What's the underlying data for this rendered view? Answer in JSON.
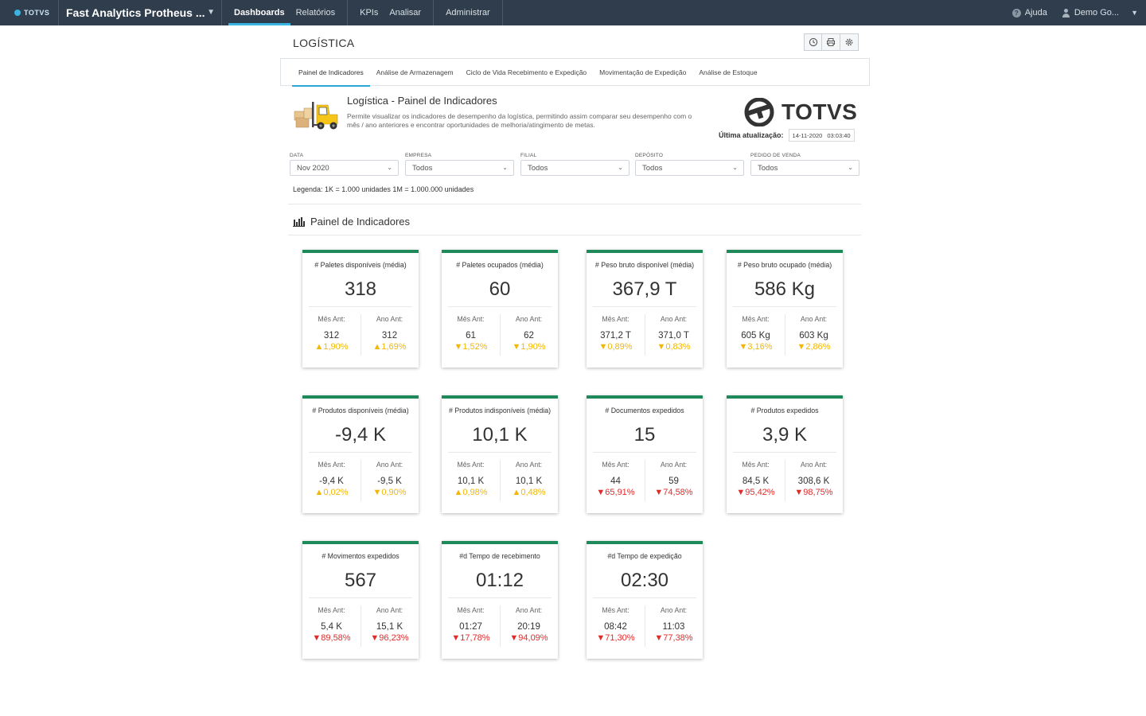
{
  "topbar": {
    "logo": "TOTVS",
    "app_name": "Fast Analytics Protheus ...",
    "nav_group1": [
      "Dashboards",
      "Relatórios"
    ],
    "nav_group2": [
      "KPIs",
      "Analisar"
    ],
    "nav_group3": [
      "Administrar"
    ],
    "help": "Ajuda",
    "user": "Demo Go..."
  },
  "page": {
    "title": "LOGÍSTICA",
    "tabs": [
      "Painel de Indicadores",
      "Análise de Armazenagem",
      "Ciclo de Vida Recebimento e Expedição",
      "Movimentação de Expedição",
      "Análise de Estoque"
    ],
    "active_tab": 0
  },
  "intro": {
    "title": "Logística - Painel de Indicadores",
    "description": "Permite visualizar os indicadores de desempenho da logística, permitindo assim comparar seu desempenho com o mês / ano anteriores e encontrar oportunidades de melhoria/atingimento de metas.",
    "brand": "TOTVS",
    "updated_label": "Última atualização:",
    "updated_date": "14-11-2020",
    "updated_time": "03:03:40"
  },
  "filters": [
    {
      "label": "DATA",
      "value": "Nov 2020"
    },
    {
      "label": "EMPRESA",
      "value": "Todos"
    },
    {
      "label": "FILIAL",
      "value": "Todos"
    },
    {
      "label": "DEPÓSITO",
      "value": "Todos"
    },
    {
      "label": "PEDIDO DE VENDA",
      "value": "Todos"
    }
  ],
  "legend": "Legenda: 1K = 1.000 unidades 1M = 1.000.000 unidades",
  "section_title": "Painel de Indicadores",
  "prev_month_label": "Mês Ant:",
  "prev_year_label": "Ano Ant:",
  "colors": {
    "accent": "#1e8a5a",
    "topbar": "#2f3d4c",
    "tab_active": "#2aa6d6",
    "warn": "#f2b705",
    "bad": "#e02b2b"
  },
  "cards": [
    {
      "title": "# Paletes disponíveis (média)",
      "value": "318",
      "prev_month": "312",
      "pm_change": "▲1,90%",
      "pm_color": "y",
      "prev_year": "312",
      "py_change": "▲1,69%",
      "py_color": "y"
    },
    {
      "title": "# Paletes ocupados (média)",
      "value": "60",
      "prev_month": "61",
      "pm_change": "▼1,52%",
      "pm_color": "y",
      "prev_year": "62",
      "py_change": "▼1,90%",
      "py_color": "y"
    },
    {
      "title": "# Peso bruto disponível (média)",
      "value": "367,9 T",
      "prev_month": "371,2 T",
      "pm_change": "▼0,89%",
      "pm_color": "y",
      "prev_year": "371,0 T",
      "py_change": "▼0,83%",
      "py_color": "y"
    },
    {
      "title": "# Peso bruto ocupado (média)",
      "value": "586 Kg",
      "prev_month": "605 Kg",
      "pm_change": "▼3,16%",
      "pm_color": "y",
      "prev_year": "603 Kg",
      "py_change": "▼2,86%",
      "py_color": "y"
    },
    {
      "title": "# Produtos disponíveis (média)",
      "value": "-9,4 K",
      "prev_month": "-9,4 K",
      "pm_change": "▲0,02%",
      "pm_color": "y",
      "prev_year": "-9,5 K",
      "py_change": "▼0,90%",
      "py_color": "y"
    },
    {
      "title": "# Produtos indisponíveis (média)",
      "value": "10,1 K",
      "prev_month": "10,1 K",
      "pm_change": "▲0,98%",
      "pm_color": "y",
      "prev_year": "10,1 K",
      "py_change": "▲0,48%",
      "py_color": "y"
    },
    {
      "title": "# Documentos expedidos",
      "value": "15",
      "prev_month": "44",
      "pm_change": "▼65,91%",
      "pm_color": "r",
      "prev_year": "59",
      "py_change": "▼74,58%",
      "py_color": "r"
    },
    {
      "title": "# Produtos expedidos",
      "value": "3,9 K",
      "prev_month": "84,5 K",
      "pm_change": "▼95,42%",
      "pm_color": "r",
      "prev_year": "308,6 K",
      "py_change": "▼98,75%",
      "py_color": "r"
    },
    {
      "title": "# Movimentos expedidos",
      "value": "567",
      "prev_month": "5,4 K",
      "pm_change": "▼89,58%",
      "pm_color": "r",
      "prev_year": "15,1 K",
      "py_change": "▼96,23%",
      "py_color": "r"
    },
    {
      "title": "#d Tempo de recebimento",
      "value": "01:12",
      "prev_month": "01:27",
      "pm_change": "▼17,78%",
      "pm_color": "r",
      "prev_year": "20:19",
      "py_change": "▼94,09%",
      "py_color": "r"
    },
    {
      "title": "#d Tempo de expedição",
      "value": "02:30",
      "prev_month": "08:42",
      "pm_change": "▼71,30%",
      "pm_color": "r",
      "prev_year": "11:03",
      "py_change": "▼77,38%",
      "py_color": "r"
    }
  ]
}
